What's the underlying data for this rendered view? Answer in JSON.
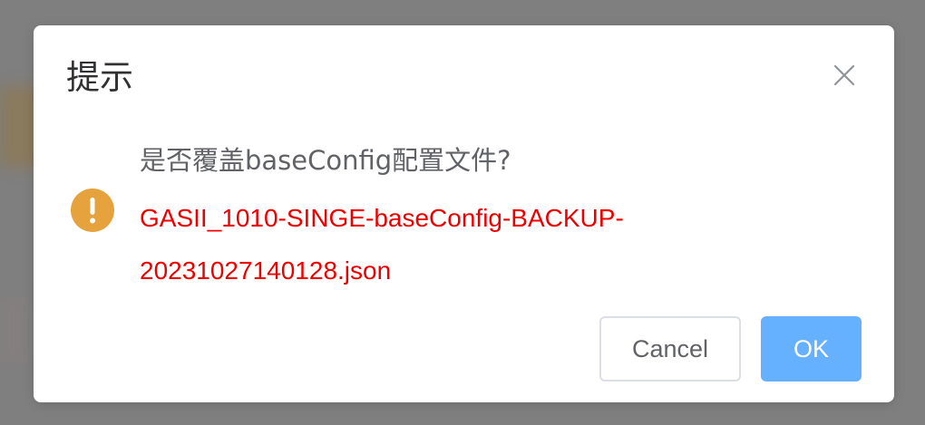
{
  "dialog": {
    "title": "提示",
    "question": "是否覆盖baseConfig配置文件?",
    "filename": "GASII_1010-SINGE-baseConfig-BACKUP-20231027140128.json",
    "icon": "warning-icon",
    "buttons": {
      "cancel_label": "Cancel",
      "ok_label": "OK"
    }
  },
  "colors": {
    "warning": "#e6a23c",
    "filename_text": "#ee0000",
    "primary_button": "#66b1ff",
    "overlay": "#7f7f7f"
  }
}
